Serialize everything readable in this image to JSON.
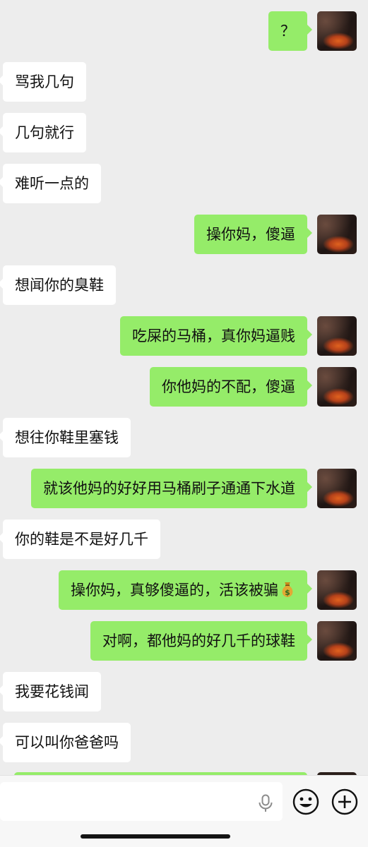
{
  "chat": {
    "messages": [
      {
        "side": "out",
        "text": "？"
      },
      {
        "side": "in",
        "text": "骂我几句"
      },
      {
        "side": "in",
        "text": "几句就行"
      },
      {
        "side": "in",
        "text": "难听一点的"
      },
      {
        "side": "out",
        "text": "操你妈，傻逼"
      },
      {
        "side": "in",
        "text": "想闻你的臭鞋"
      },
      {
        "side": "out",
        "text": "吃屎的马桶，真你妈逼贱"
      },
      {
        "side": "out",
        "text": "你他妈的不配，傻逼"
      },
      {
        "side": "in",
        "text": "想往你鞋里塞钱"
      },
      {
        "side": "out",
        "text": "就该他妈的好好用马桶刷子通通下水道"
      },
      {
        "side": "in",
        "text": "你的鞋是不是好几千"
      },
      {
        "side": "out",
        "text": "操你妈，真够傻逼的，活该被骗",
        "emoji": "money-bag-icon"
      },
      {
        "side": "out",
        "text": "对啊，都他妈的好几千的球鞋"
      },
      {
        "side": "in",
        "text": "我要花钱闻"
      },
      {
        "side": "in",
        "text": "可以叫你爸爸吗"
      }
    ]
  },
  "input_bar": {
    "text_value": "",
    "icons": [
      "microphone-icon",
      "emoji-icon",
      "plus-icon"
    ]
  },
  "colors": {
    "background": "#ededed",
    "incoming_bubble": "#ffffff",
    "outgoing_bubble": "#95ec69",
    "input_bar": "#f7f7f7"
  }
}
